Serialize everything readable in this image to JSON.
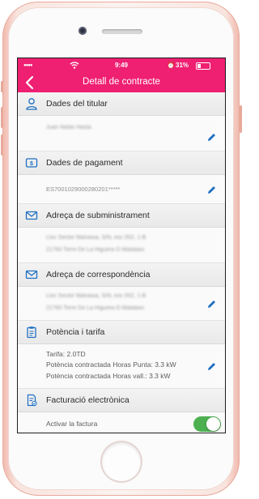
{
  "status_bar": {
    "time": "9:49",
    "battery": "31%"
  },
  "nav": {
    "title": "Detall de contracte"
  },
  "sections": {
    "titular": {
      "label": "Dades del titular",
      "value": "Juan Nebio Hasta"
    },
    "pagament": {
      "label": "Dades de pagament",
      "value": "ES7001029000280201*****"
    },
    "subministrament": {
      "label": "Adreça de subministrament",
      "line1": "Lloc Sector Malvasia, S/N, esc 002, 1-B",
      "line2": "21760 Torre De La Higuera O Matalasc"
    },
    "correspondencia": {
      "label": "Adreça de correspondència",
      "line1": "Lloc Sector Malvasia, S/N, esc 002, 1-B",
      "line2": "21760 Torre De La Higuera O Matalasc"
    },
    "potencia": {
      "label": "Potència i tarifa",
      "tarifa": "Tarifa: 2.0TD",
      "punta": "Potència contractada Horas Punta: 3.3 kW",
      "vall": "Potència contractada Horas vall.: 3.3 kW"
    },
    "facturacio": {
      "label": "Facturació electrònica",
      "toggle_label": "Activar la factura",
      "enabled": true
    }
  },
  "colors": {
    "brand": "#ef1f72",
    "icon": "#1e6fc1",
    "toggle_on": "#4caf50"
  }
}
